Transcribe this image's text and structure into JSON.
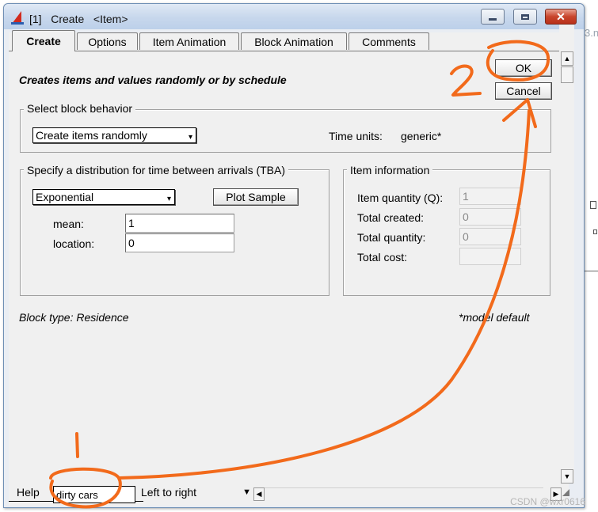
{
  "window": {
    "title": "[1]   Create   <Item>",
    "controls": {
      "minimize": "minimize",
      "maximize": "maximize",
      "close": "✕"
    }
  },
  "tabs": [
    {
      "label": "Create",
      "active": true
    },
    {
      "label": "Options",
      "active": false
    },
    {
      "label": "Item Animation",
      "active": false
    },
    {
      "label": "Block Animation",
      "active": false
    },
    {
      "label": "Comments",
      "active": false
    }
  ],
  "header": {
    "description": "Creates items and values randomly or by schedule",
    "ok_label": "OK",
    "cancel_label": "Cancel"
  },
  "block_behavior": {
    "group_title": "Select block behavior",
    "selected": "Create items randomly",
    "time_units_label": "Time units:",
    "time_units_value": "generic*"
  },
  "distribution": {
    "group_title": "Specify a distribution for time between arrivals (TBA)",
    "selected": "Exponential",
    "plot_button": "Plot Sample",
    "params": [
      {
        "label": "mean:",
        "value": "1"
      },
      {
        "label": "location:",
        "value": "0"
      }
    ]
  },
  "item_info": {
    "group_title": "Item information",
    "rows": [
      {
        "label": "Item quantity (Q):",
        "value": "1"
      },
      {
        "label": "Total created:",
        "value": "0"
      },
      {
        "label": "Total quantity:",
        "value": "0"
      },
      {
        "label": "Total cost:",
        "value": ""
      }
    ]
  },
  "footer": {
    "block_type": "Block type:  Residence",
    "model_default_note": "*model default"
  },
  "statusbar": {
    "help_label": "Help",
    "block_label_value": "dirty cars",
    "direction_selected": "Left to right"
  },
  "background": {
    "fragment_text": "3.n",
    "watermark": "CSDN @wxr0616"
  },
  "annotations": {
    "color": "#f26a1b",
    "marker_1": "1",
    "marker_2": "2"
  },
  "colors": {
    "title_bar": "#c7d7ec",
    "dialog_bg": "#f0f0f0",
    "close_button": "#c8452c",
    "annotation": "#f26a1b"
  }
}
